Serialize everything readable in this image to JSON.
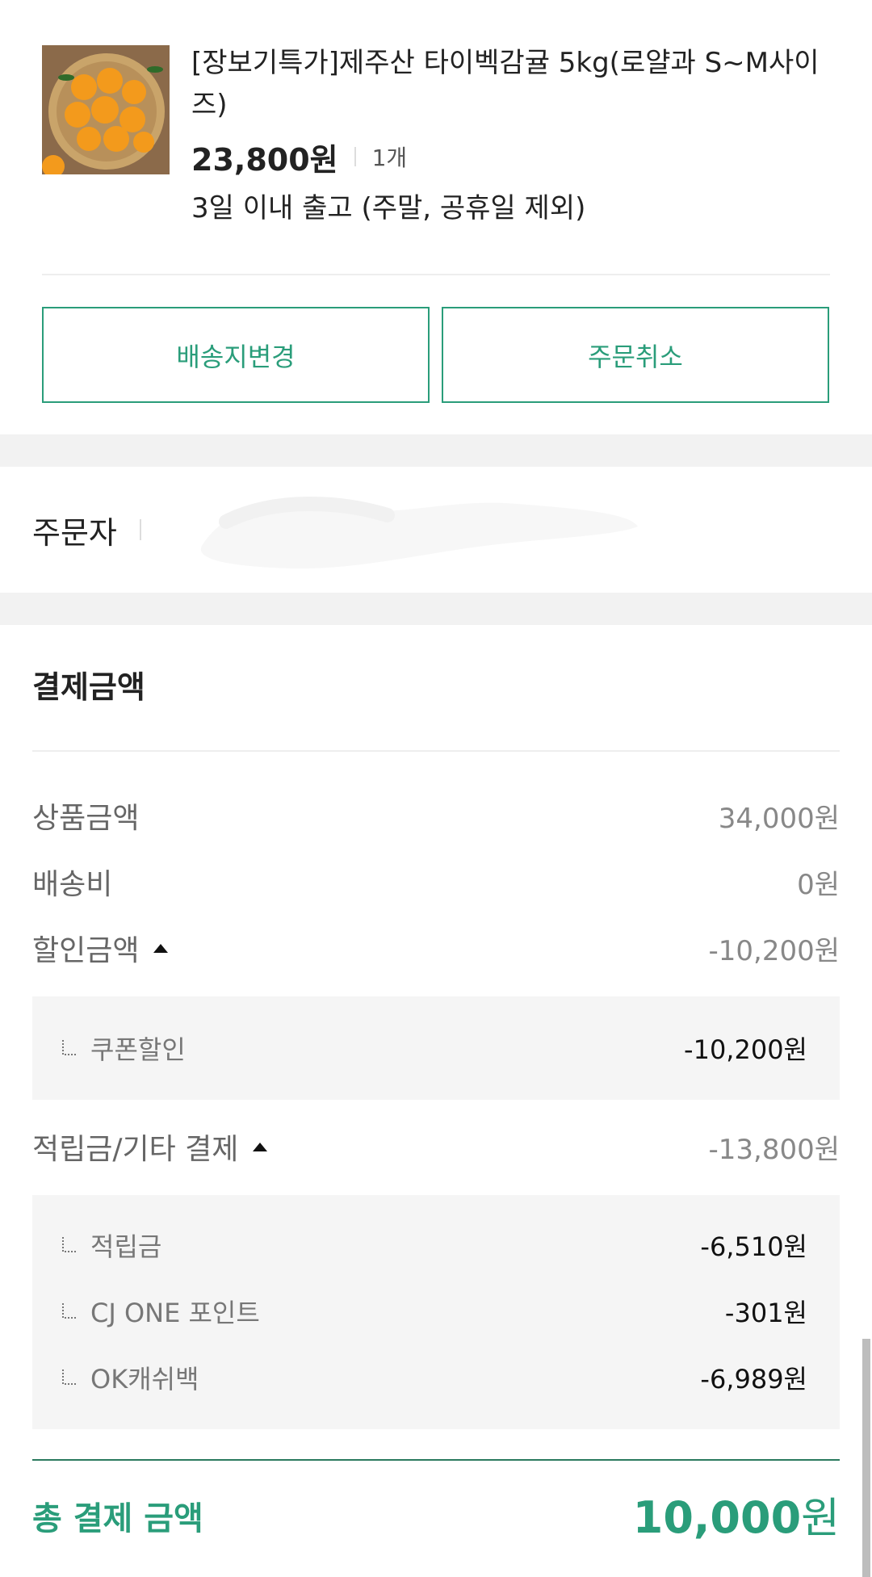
{
  "product": {
    "name": "[장보기특가]제주산 타이벡감귤 5kg(로얄과 S~M사이즈)",
    "price": "23,800원",
    "quantity": "1개",
    "shipping_note": "3일 이내 출고 (주말, 공휴일 제외)"
  },
  "actions": {
    "change_address": "배송지변경",
    "cancel_order": "주문취소"
  },
  "orderer": {
    "label": "주문자"
  },
  "payment": {
    "title": "결제금액",
    "product_amount_label": "상품금액",
    "product_amount": "34,000원",
    "shipping_fee_label": "배송비",
    "shipping_fee": "0원",
    "discount_label": "할인금액",
    "discount_amount": "-10,200원",
    "discount_items": [
      {
        "label": "쿠폰할인",
        "value": "-10,200원"
      }
    ],
    "points_label": "적립금/기타 결제",
    "points_amount": "-13,800원",
    "points_items": [
      {
        "label": "적립금",
        "value": "-6,510원"
      },
      {
        "label": "CJ ONE 포인트",
        "value": "-301원"
      },
      {
        "label": "OK캐쉬백",
        "value": "-6,989원"
      }
    ],
    "total_label": "총 결제 금액",
    "total_number": "10,000",
    "total_unit": "원"
  },
  "colors": {
    "accent": "#2a9d7a",
    "section_gap": "#f2f2f2",
    "subbox_bg": "#f5f5f5"
  }
}
